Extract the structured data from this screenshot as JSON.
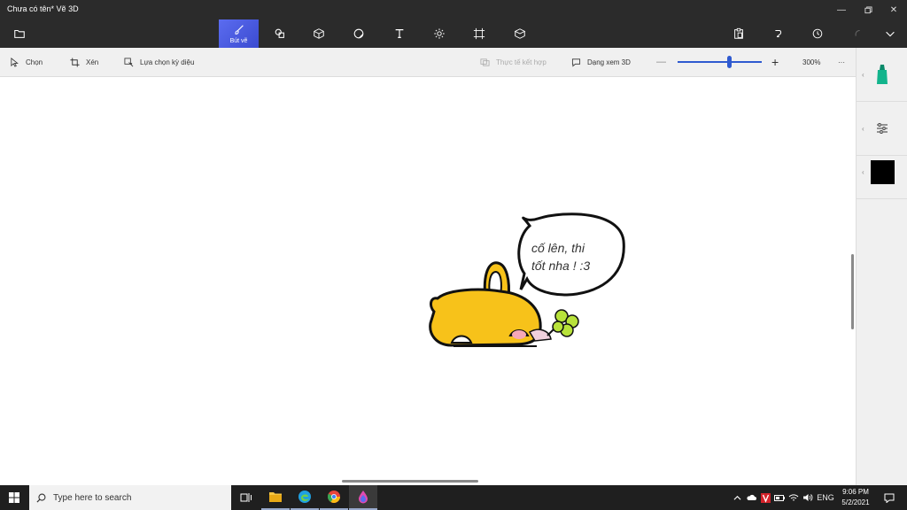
{
  "window": {
    "title": "Chưa có tên*   Vẽ 3D"
  },
  "ribbon": {
    "active_tool_label": "Bút vẽ"
  },
  "commandbar": {
    "select": "Chọn",
    "crop": "Xén",
    "magic_select": "Lựa chọn kỳ diệu",
    "mixed_reality": "Thực tế kết hợp",
    "view_3d": "Dạng xem 3D",
    "zoom_percent": "300%",
    "zoom_level": 0.62,
    "more": "···"
  },
  "canvas": {
    "speech_line1": "cố lên, thi",
    "speech_line2": "tốt nha ! :3"
  },
  "sidepanel": {
    "color_swatch": "#000000"
  },
  "taskbar": {
    "search_placeholder": "Type here to search",
    "language": "ENG",
    "time": "9:06 PM",
    "date": "5/2/2021"
  },
  "colors": {
    "accent": "#4a5ce8",
    "bunny": "#f7c21a",
    "clover": "#b8e23a"
  }
}
